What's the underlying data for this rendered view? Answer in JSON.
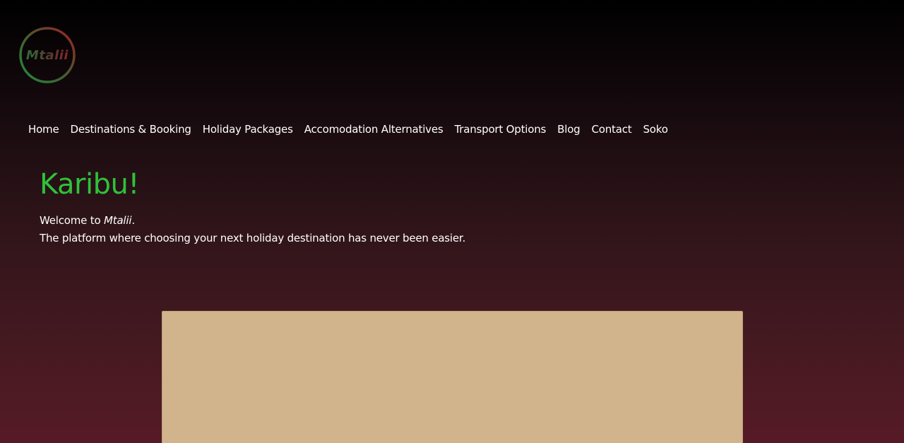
{
  "logo": {
    "text": "Mtalii",
    "ring_colors": [
      "#1f8a3c",
      "#a01e24"
    ]
  },
  "nav": {
    "items": [
      {
        "label": "Home"
      },
      {
        "label": "Destinations & Booking"
      },
      {
        "label": "Holiday Packages"
      },
      {
        "label": "Accomodation Alternatives"
      },
      {
        "label": "Transport Options"
      },
      {
        "label": "Blog"
      },
      {
        "label": "Contact"
      },
      {
        "label": "Soko"
      }
    ]
  },
  "hero": {
    "title": "Karibu!",
    "welcome_prefix": "Welcome to ",
    "welcome_brand": "Mtalii",
    "welcome_suffix": ".",
    "tagline": "The platform where choosing your next holiday destination has never been easier."
  },
  "colors": {
    "title": "#2fc13a",
    "panel": "#d2b48c",
    "background_top": "#000000",
    "background_bottom": "#561a26"
  }
}
